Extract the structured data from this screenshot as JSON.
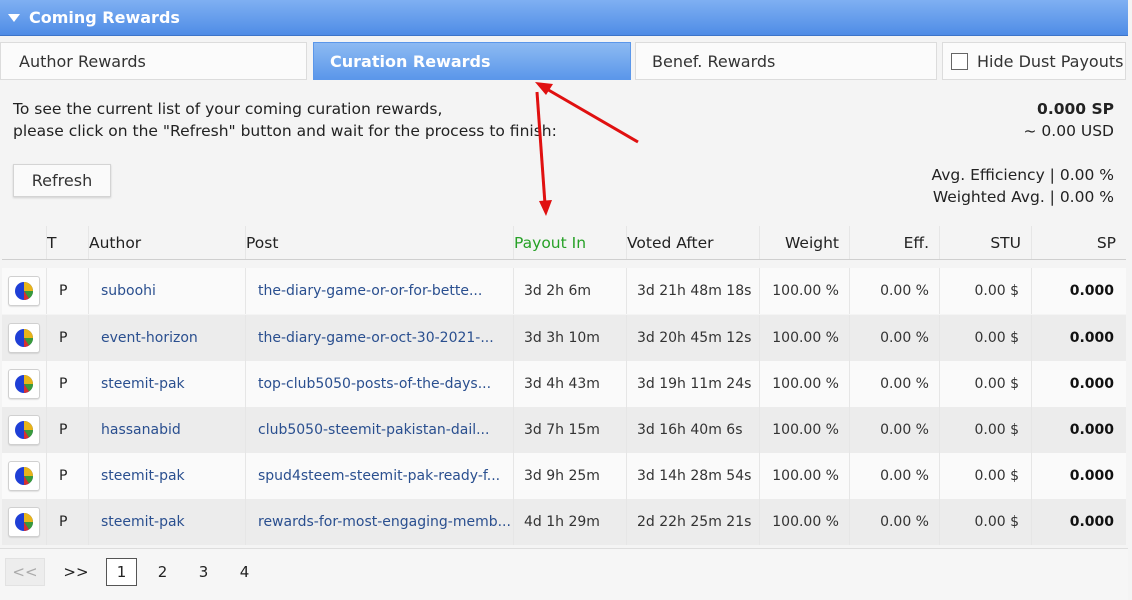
{
  "header": {
    "title": "Coming Rewards"
  },
  "tabs": {
    "author": "Author Rewards",
    "curation": "Curation Rewards",
    "benef": "Benef. Rewards",
    "hide_dust": "Hide Dust Payouts"
  },
  "info": {
    "line1": "To see the current list of your coming curation rewards,",
    "line2": "please click on the \"Refresh\" button and wait for the process to finish:",
    "sp_total": "0.000 SP",
    "usd_total": "~ 0.00 USD",
    "refresh_label": "Refresh",
    "avg_eff": "Avg. Efficiency | 0.00 %",
    "weighted_avg": "Weighted Avg. | 0.00 %"
  },
  "table": {
    "headers": {
      "t": "T",
      "author": "Author",
      "post": "Post",
      "payout": "Payout In",
      "voted": "Voted After",
      "weight": "Weight",
      "eff": "Eff.",
      "stu": "STU",
      "sp": "SP"
    },
    "rows": [
      {
        "t": "P",
        "author": "suboohi",
        "post": "the-diary-game-or-or-for-bette...",
        "payout": "3d 2h 6m",
        "voted": "3d 21h 48m 18s",
        "weight": "100.00 %",
        "eff": "0.00 %",
        "stu": "0.00 $",
        "sp": "0.000"
      },
      {
        "t": "P",
        "author": "event-horizon",
        "post": "the-diary-game-or-oct-30-2021-...",
        "payout": "3d 3h 10m",
        "voted": "3d 20h 45m 12s",
        "weight": "100.00 %",
        "eff": "0.00 %",
        "stu": "0.00 $",
        "sp": "0.000"
      },
      {
        "t": "P",
        "author": "steemit-pak",
        "post": "top-club5050-posts-of-the-days...",
        "payout": "3d 4h 43m",
        "voted": "3d 19h 11m 24s",
        "weight": "100.00 %",
        "eff": "0.00 %",
        "stu": "0.00 $",
        "sp": "0.000"
      },
      {
        "t": "P",
        "author": "hassanabid",
        "post": "club5050-steemit-pakistan-dail...",
        "payout": "3d 7h 15m",
        "voted": "3d 16h 40m 6s",
        "weight": "100.00 %",
        "eff": "0.00 %",
        "stu": "0.00 $",
        "sp": "0.000"
      },
      {
        "t": "P",
        "author": "steemit-pak",
        "post": "spud4steem-steemit-pak-ready-f...",
        "payout": "3d 9h 25m",
        "voted": "3d 14h 28m 54s",
        "weight": "100.00 %",
        "eff": "0.00 %",
        "stu": "0.00 $",
        "sp": "0.000"
      },
      {
        "t": "P",
        "author": "steemit-pak",
        "post": "rewards-for-most-engaging-memb...",
        "payout": "4d 1h 29m",
        "voted": "2d 22h 25m 21s",
        "weight": "100.00 %",
        "eff": "0.00 %",
        "stu": "0.00 $",
        "sp": "0.000"
      }
    ]
  },
  "pager": {
    "prev": "<<",
    "next": ">>",
    "pages": [
      "1",
      "2",
      "3",
      "4"
    ],
    "current": "1"
  },
  "colors": {
    "accent_blue": "#5b97ea",
    "payout_green": "#27a127",
    "annotation_red": "#e01010"
  }
}
